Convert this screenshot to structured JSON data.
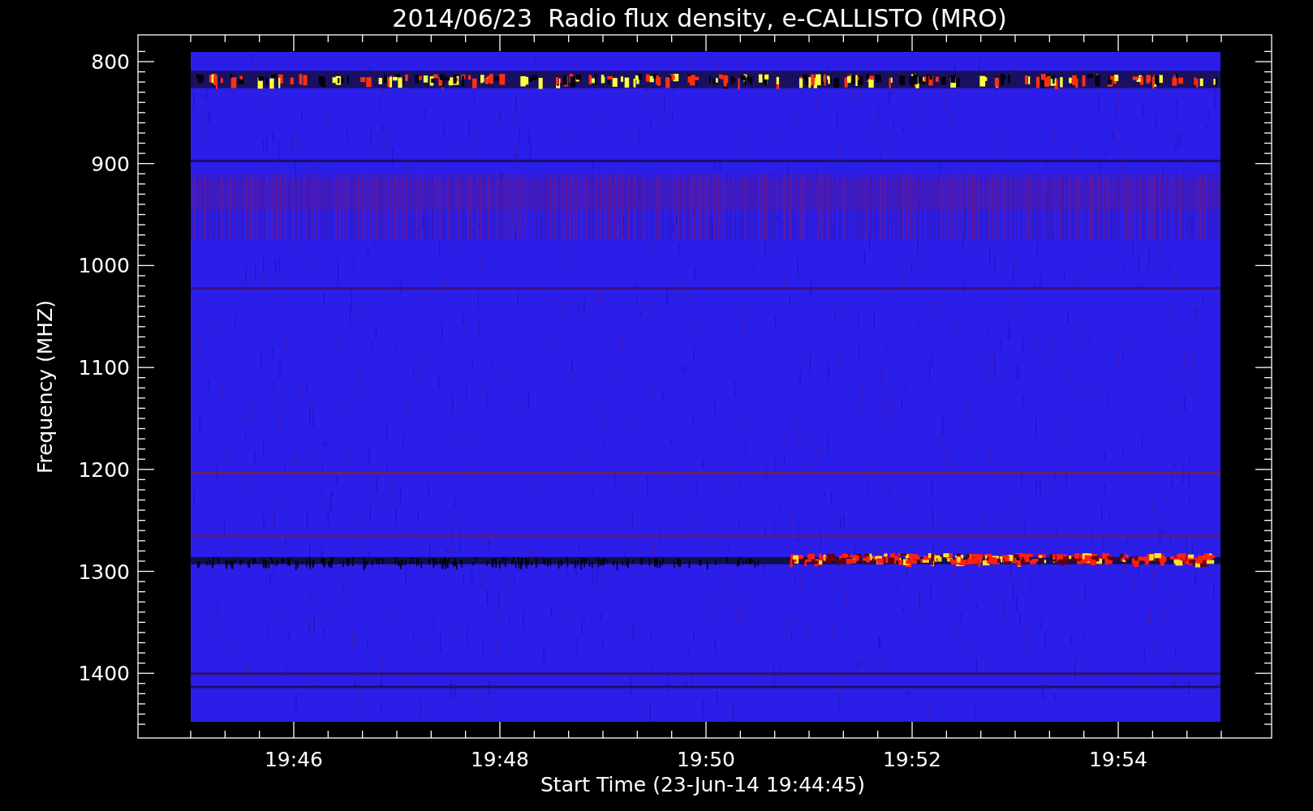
{
  "plot": {
    "title": "2014/06/23  Radio flux density, e-CALLISTO (MRO)",
    "xlabel": "Start Time (23-Jun-14 19:44:45)",
    "ylabel": "Frequency (MHZ)",
    "x_tick_labels": [
      "19:46",
      "19:48",
      "19:50",
      "19:52",
      "19:54"
    ],
    "y_tick_labels": [
      "800",
      "900",
      "1000",
      "1100",
      "1200",
      "1300",
      "1400"
    ]
  }
}
